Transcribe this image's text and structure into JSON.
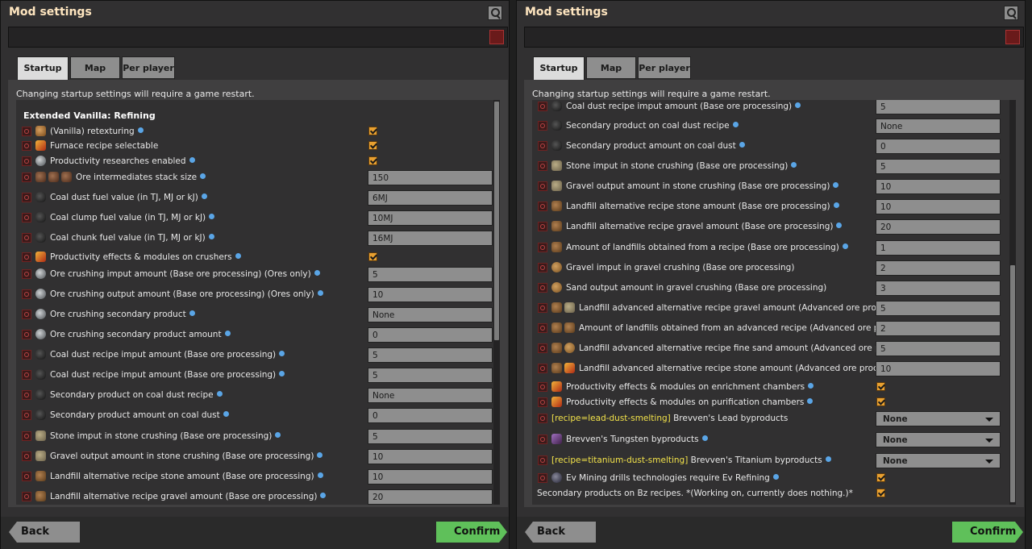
{
  "left": {
    "title": "Mod settings",
    "tabs": [
      "Startup",
      "Map",
      "Per player"
    ],
    "notice": "Changing startup settings will require a game restart.",
    "section_title": "Extended Vanilla: Refining",
    "back": "Back",
    "confirm": "Confirm",
    "rows": [
      {
        "icons": [
          "gear"
        ],
        "label": "(Vanilla) retexturing",
        "info": true,
        "type": "check"
      },
      {
        "icons": [
          "crusher"
        ],
        "label": "Furnace recipe selectable",
        "info": false,
        "type": "check"
      },
      {
        "icons": [
          "drill"
        ],
        "label": "Productivity researches enabled",
        "info": true,
        "type": "check"
      },
      {
        "icons": [
          "rock",
          "rock",
          "rock"
        ],
        "label": "Ore intermediates stack size",
        "info": true,
        "type": "text",
        "value": "150"
      },
      {
        "icons": [
          "coal"
        ],
        "label": "Coal dust fuel value (in TJ, MJ or kJ)",
        "info": true,
        "type": "text",
        "value": "6MJ"
      },
      {
        "icons": [
          "coal"
        ],
        "label": "Coal clump fuel value (in TJ, MJ or kJ)",
        "info": true,
        "type": "text",
        "value": "10MJ"
      },
      {
        "icons": [
          "coal"
        ],
        "label": "Coal chunk fuel value (in TJ, MJ or kJ)",
        "info": true,
        "type": "text",
        "value": "16MJ"
      },
      {
        "icons": [
          "crusher"
        ],
        "label": "Productivity effects & modules on crushers",
        "info": true,
        "type": "check"
      },
      {
        "icons": [
          "drill"
        ],
        "label": "Ore crushing imput amount (Base ore processing) (Ores only)",
        "info": true,
        "type": "text",
        "value": "5"
      },
      {
        "icons": [
          "drill"
        ],
        "label": "Ore crushing output amount (Base ore processing) (Ores only)",
        "info": true,
        "type": "text",
        "value": "10"
      },
      {
        "icons": [
          "drill"
        ],
        "label": "Ore crushing secondary product",
        "info": true,
        "type": "text",
        "value": "None"
      },
      {
        "icons": [
          "drill"
        ],
        "label": "Ore crushing secondary product amount",
        "info": true,
        "type": "text",
        "value": "0"
      },
      {
        "icons": [
          "coal"
        ],
        "label": "Coal dust recipe imput amount (Base ore processing)",
        "info": true,
        "type": "text",
        "value": "5"
      },
      {
        "icons": [
          "coal"
        ],
        "label": "Coal dust recipe imput amount (Base ore processing)",
        "info": true,
        "type": "text",
        "value": "5"
      },
      {
        "icons": [
          "coal"
        ],
        "label": "Secondary product on coal dust recipe",
        "info": true,
        "type": "text",
        "value": "None"
      },
      {
        "icons": [
          "coal"
        ],
        "label": "Secondary product amount on coal dust",
        "info": true,
        "type": "text",
        "value": "0"
      },
      {
        "icons": [
          "stone"
        ],
        "label": "Stone imput in stone crushing (Base ore processing)",
        "info": true,
        "type": "text",
        "value": "5"
      },
      {
        "icons": [
          "stone"
        ],
        "label": "Gravel output amount in stone crushing (Base ore processing)",
        "info": true,
        "type": "text",
        "value": "10"
      },
      {
        "icons": [
          "landfill"
        ],
        "label": "Landfill alternative recipe stone amount (Base ore processing)",
        "info": true,
        "type": "text",
        "value": "10"
      },
      {
        "icons": [
          "landfill"
        ],
        "label": "Landfill alternative recipe gravel amount (Base ore processing)",
        "info": true,
        "type": "text",
        "value": "20"
      }
    ]
  },
  "right": {
    "title": "Mod settings",
    "tabs": [
      "Startup",
      "Map",
      "Per player"
    ],
    "notice": "Changing startup settings will require a game restart.",
    "back": "Back",
    "confirm": "Confirm",
    "rows": [
      {
        "icons": [
          "coal"
        ],
        "label": "Coal dust recipe imput amount (Base ore processing)",
        "info": true,
        "type": "text",
        "value": "5"
      },
      {
        "icons": [
          "coal"
        ],
        "label": "Secondary product on coal dust recipe",
        "info": true,
        "type": "text",
        "value": "None"
      },
      {
        "icons": [
          "coal"
        ],
        "label": "Secondary product amount on coal dust",
        "info": true,
        "type": "text",
        "value": "0"
      },
      {
        "icons": [
          "stone"
        ],
        "label": "Stone imput in stone crushing (Base ore processing)",
        "info": true,
        "type": "text",
        "value": "5"
      },
      {
        "icons": [
          "stone"
        ],
        "label": "Gravel output amount in stone crushing (Base ore processing)",
        "info": true,
        "type": "text",
        "value": "10"
      },
      {
        "icons": [
          "landfill"
        ],
        "label": "Landfill alternative recipe stone amount (Base ore processing)",
        "info": true,
        "type": "text",
        "value": "10"
      },
      {
        "icons": [
          "landfill"
        ],
        "label": "Landfill alternative recipe gravel amount (Base ore processing)",
        "info": true,
        "type": "text",
        "value": "20"
      },
      {
        "icons": [
          "landfill"
        ],
        "label": "Amount of landfills obtained from a recipe (Base ore processing)",
        "info": true,
        "type": "text",
        "value": "1"
      },
      {
        "icons": [
          "gravel"
        ],
        "label": "Gravel imput in gravel crushing (Base ore processing)",
        "info": false,
        "type": "text",
        "value": "2"
      },
      {
        "icons": [
          "gravel"
        ],
        "label": "Sand output amount in gravel crushing (Base ore processing)",
        "info": false,
        "type": "text",
        "value": "3"
      },
      {
        "icons": [
          "landfill",
          "stone"
        ],
        "label": "Landfill advanced alternative recipe gravel amount (Advanced ore processing)",
        "info": false,
        "type": "text",
        "value": "5"
      },
      {
        "icons": [
          "landfill",
          "landfill"
        ],
        "label": "Amount of landfills obtained from an advanced recipe (Advanced ore processing)",
        "info": false,
        "type": "text",
        "value": "2"
      },
      {
        "icons": [
          "landfill",
          "gravel"
        ],
        "label": "Landfill advanced alternative recipe fine sand amount (Advanced ore processing)",
        "info": false,
        "type": "text",
        "value": "5"
      },
      {
        "icons": [
          "landfill",
          "crusher"
        ],
        "label": "Landfill advanced alternative recipe stone amount (Advanced ore processing)",
        "info": false,
        "type": "text",
        "value": "10"
      },
      {
        "icons": [
          "crusher"
        ],
        "label": "Productivity effects & modules on enrichment chambers",
        "info": true,
        "type": "check"
      },
      {
        "icons": [
          "crusher"
        ],
        "label": "Productivity effects & modules on purification chambers",
        "info": true,
        "type": "check"
      },
      {
        "icons": [],
        "tag": "[recipe=lead-dust-smelting]",
        "label": " Brevven's Lead byproducts",
        "info": false,
        "type": "dropdown",
        "value": "None"
      },
      {
        "icons": [
          "tungsten"
        ],
        "label": "Brevven's Tungsten byproducts",
        "info": true,
        "type": "dropdown",
        "value": "None"
      },
      {
        "icons": [],
        "tag": "[recipe=titanium-dust-smelting]",
        "label": " Brevven's Titanium byproducts",
        "info": true,
        "type": "dropdown",
        "value": "None"
      },
      {
        "icons": [
          "mining"
        ],
        "label": "Ev Mining drills technologies require Ev Refining",
        "info": true,
        "type": "check"
      },
      {
        "icons": [],
        "label": "Secondary products on Bz recipes. *(Working on, currently does nothing.)*",
        "info": false,
        "type": "check",
        "noreset": true
      }
    ]
  }
}
